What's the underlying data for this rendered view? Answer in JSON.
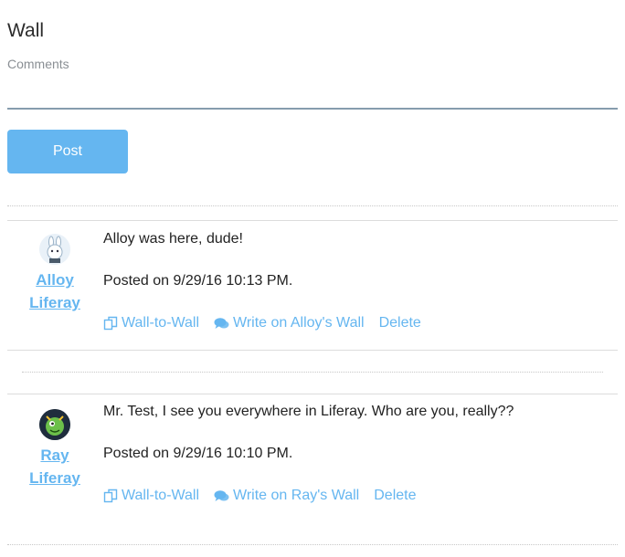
{
  "page": {
    "title": "Wall"
  },
  "comment_form": {
    "label": "Comments",
    "value": "",
    "post_label": "Post"
  },
  "entries": [
    {
      "author": {
        "first": "Alloy",
        "last": "Liferay",
        "avatar": "alloy-bunny-avatar"
      },
      "message": "Alloy was here, dude!",
      "posted": "Posted on 9/29/16 10:13 PM.",
      "actions": {
        "wall_to_wall": "Wall-to-Wall",
        "write_on_wall": "Write on Alloy's Wall",
        "delete": "Delete"
      }
    },
    {
      "author": {
        "first": "Ray",
        "last": "Liferay",
        "avatar": "ray-green-creature-avatar"
      },
      "message": "Mr. Test, I see you everywhere in Liferay. Who are you, really??",
      "posted": "Posted on 9/29/16 10:10 PM.",
      "actions": {
        "wall_to_wall": "Wall-to-Wall",
        "write_on_wall": "Write on Ray's Wall",
        "delete": "Delete"
      }
    }
  ],
  "icons": {
    "wall_to_wall": "copy-icon",
    "write_on_wall": "comments-icon"
  },
  "colors": {
    "accent": "#65b6f0",
    "input_border": "#869cad"
  }
}
